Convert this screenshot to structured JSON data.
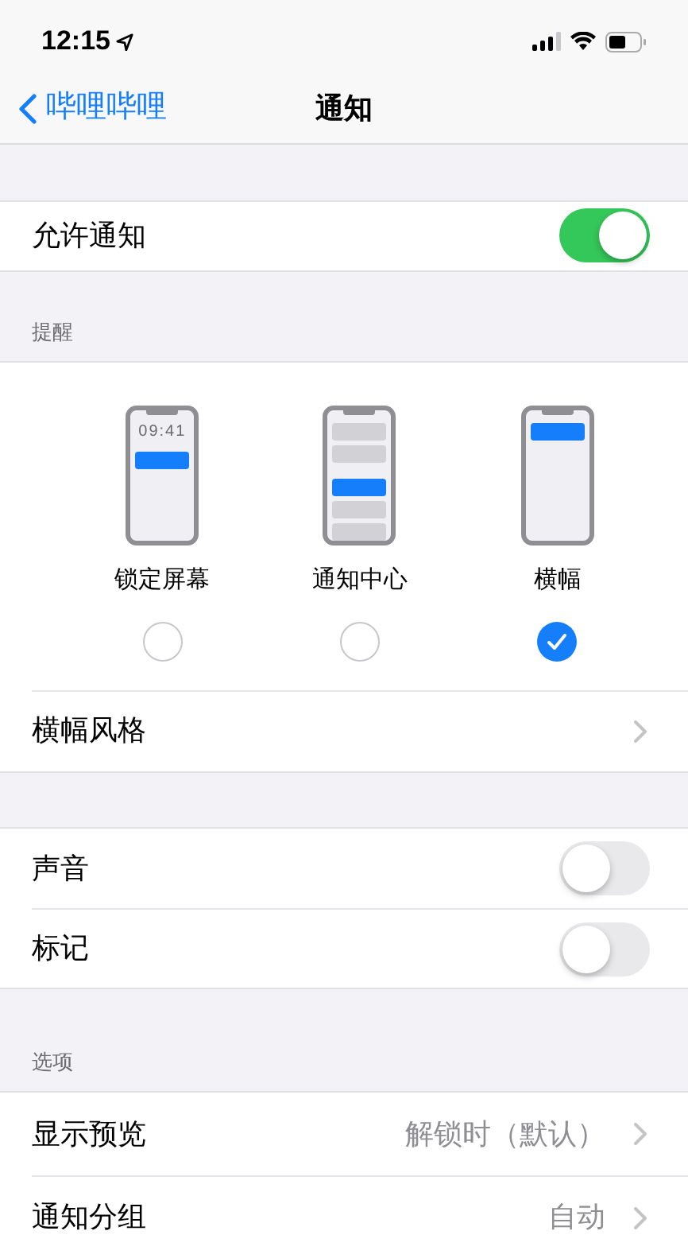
{
  "status_bar": {
    "time": "12:15"
  },
  "nav": {
    "back_label": "哔哩哔哩",
    "title": "通知"
  },
  "allow": {
    "label": "允许通知",
    "on": true
  },
  "alerts": {
    "header": "提醒",
    "styles": [
      {
        "kind": "lock",
        "label": "锁定屏幕",
        "clock": "09:41",
        "selected": false
      },
      {
        "kind": "center",
        "label": "通知中心",
        "selected": false
      },
      {
        "kind": "banner",
        "label": "横幅",
        "selected": true
      }
    ],
    "banner_style": {
      "label": "横幅风格"
    }
  },
  "sound_group": [
    {
      "kind": "toggle",
      "label": "声音",
      "on": false
    },
    {
      "kind": "toggle",
      "label": "标记",
      "on": false
    }
  ],
  "options": {
    "header": "选项",
    "items": [
      {
        "kind": "disclosure",
        "label": "显示预览",
        "value": "解锁时（默认）"
      },
      {
        "kind": "disclosure",
        "label": "通知分组",
        "value": "自动"
      }
    ]
  }
}
